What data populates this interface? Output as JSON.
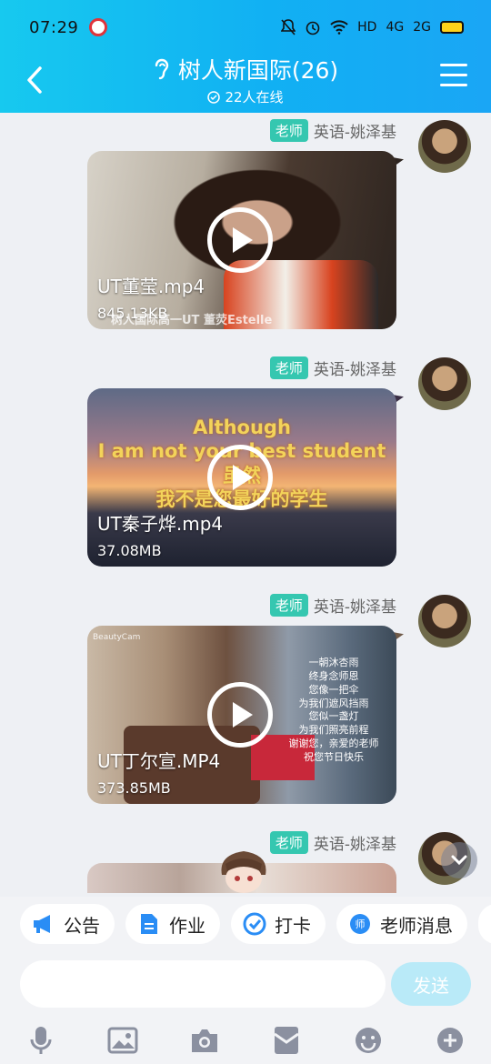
{
  "status_bar": {
    "time": "07:29",
    "indicators": [
      "HD",
      "4G",
      "2G"
    ]
  },
  "header": {
    "title": "树人新国际(26)",
    "online_count": "22人在线"
  },
  "messages": [
    {
      "role_tag": "老师",
      "sender": "英语-姚泽基",
      "video_name": "UT董莹.mp4",
      "video_size": "845.13KB",
      "watermark": "树人国际高一UT 董荧Estelle"
    },
    {
      "role_tag": "老师",
      "sender": "英语-姚泽基",
      "video_name": "UT秦子烨.mp4",
      "video_size": "37.08MB",
      "overlay_lines": [
        "Although",
        "I am not your best student",
        "虽然",
        "我不是您最好的学生"
      ]
    },
    {
      "role_tag": "老师",
      "sender": "英语-姚泽基",
      "video_name": "UT丁尔宣.MP4",
      "video_size": "373.85MB",
      "brand_mark": "BeautyCam",
      "poem_lines": [
        "一朝沐杏雨",
        "终身念师恩",
        "您像一把伞",
        "为我们遮风挡雨",
        "您似一盏灯",
        "为我们照亮前程",
        "谢谢您，亲爱的老师",
        "祝您节日快乐"
      ]
    },
    {
      "role_tag": "老师",
      "sender": "英语-姚泽基"
    }
  ],
  "quick_actions": [
    {
      "label": "公告",
      "icon": "megaphone-icon"
    },
    {
      "label": "作业",
      "icon": "document-icon"
    },
    {
      "label": "打卡",
      "icon": "check-circle-icon"
    },
    {
      "label": "老师消息",
      "icon": "teacher-message-icon"
    }
  ],
  "composer": {
    "placeholder": "",
    "send_label": "发送"
  },
  "toolbar_icons": [
    "microphone-icon",
    "image-icon",
    "camera-icon",
    "redpacket-icon",
    "emoji-icon",
    "plus-icon"
  ],
  "colors": {
    "header_gradient_start": "#17c9ef",
    "header_gradient_end": "#1aa6f5",
    "role_tag": "#35c7b0",
    "send_button": "#b9eaf8",
    "background": "#eef0f4"
  }
}
